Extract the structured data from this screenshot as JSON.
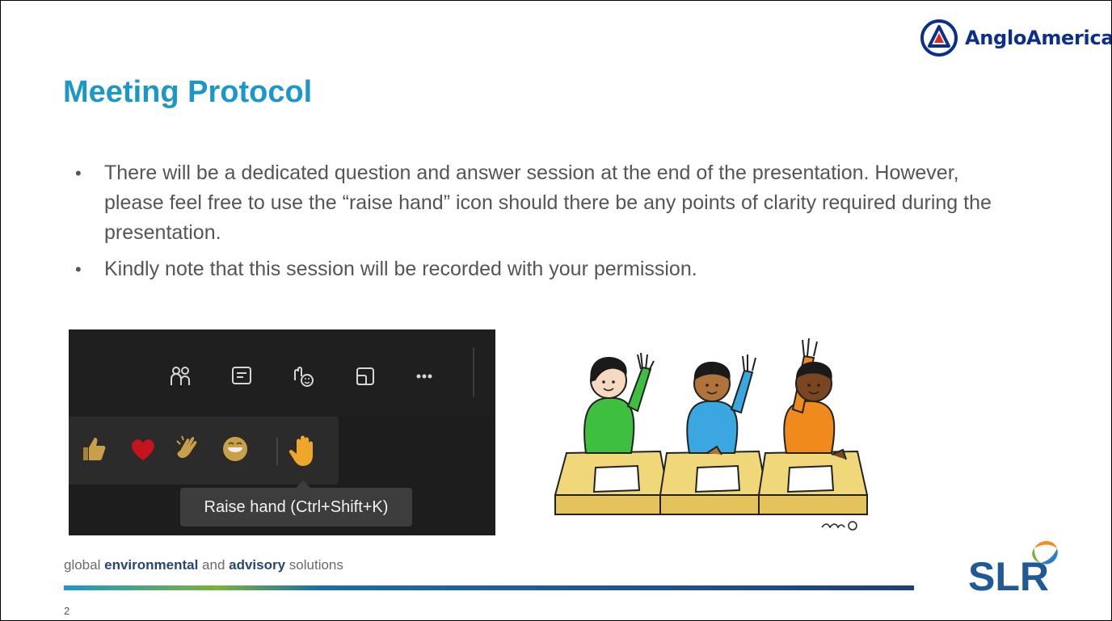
{
  "slide": {
    "title": "Meeting Protocol",
    "bullets": [
      "There will be a dedicated question and answer session at the end of the presentation. However, please feel free to use the “raise hand” icon should there be any points of clarity required during the presentation.",
      "Kindly note that this session will be recorded with your permission."
    ],
    "page_number": "2"
  },
  "brand": {
    "anglo_name": "AngloAmerican",
    "slr_name": "SLR",
    "tagline_parts": [
      "global ",
      "environmental",
      " and ",
      "advisory",
      " solutions"
    ]
  },
  "teams": {
    "toolbar_icons": [
      "people-icon",
      "chat-icon",
      "reactions-icon",
      "share-icon",
      "more-icon"
    ],
    "reactions": [
      "like-icon",
      "heart-icon",
      "applause-icon",
      "laugh-icon",
      "raise-hand-icon"
    ],
    "tooltip": "Raise hand (Ctrl+Shift+K)"
  },
  "colors": {
    "title": "#1b98c8",
    "anglo_blue": "#0a2f8c",
    "slr_blue": "#1f5a96"
  }
}
